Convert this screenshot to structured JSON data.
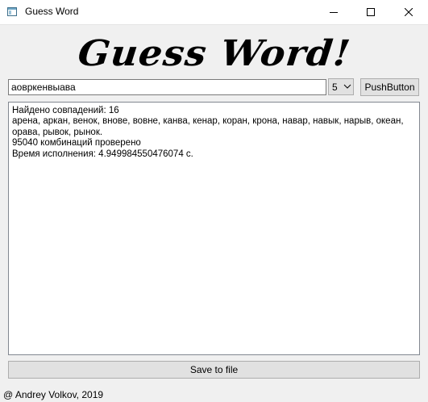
{
  "window": {
    "title": "Guess Word",
    "icon": "app-window-icon"
  },
  "banner": {
    "text": "Guess Word!"
  },
  "input": {
    "value": "аовркенвыава"
  },
  "letters_select": {
    "selected": "5"
  },
  "push_button": {
    "label": "PushButton"
  },
  "output": {
    "lines": [
      "Найдено совпадений: 16",
      "арена, аркан, венок, внове, вовне, канва, кенар, коран, крона, навар, навык, нарыв, океан, орава, рывок, рынок.",
      "95040 комбинаций проверено",
      "Время исполнения: 4.949984550476074 с."
    ]
  },
  "save_button": {
    "label": "Save to file"
  },
  "footer": {
    "text": "@ Andrey Volkov, 2019"
  }
}
